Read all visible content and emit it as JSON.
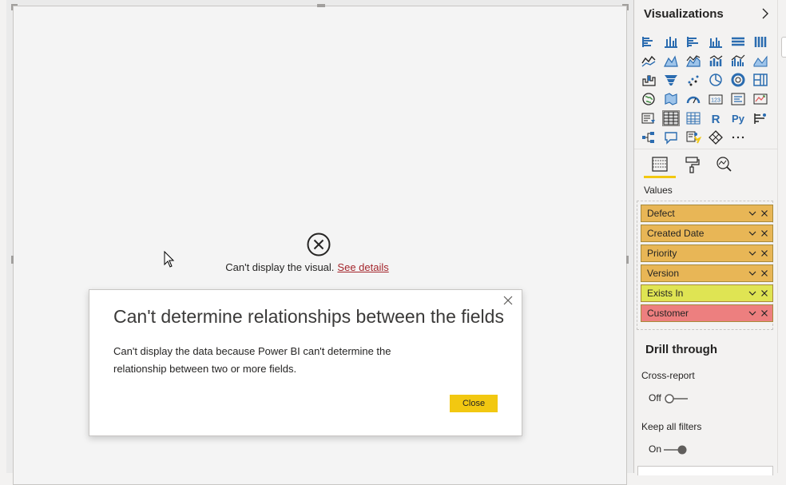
{
  "canvas": {
    "error_message": "Can't display the visual.",
    "error_link": "See details"
  },
  "dialog": {
    "title": "Can't determine relationships between the fields",
    "body": "Can't display the data because Power BI can't determine the relationship between two or more fields.",
    "close_button": "Close"
  },
  "visualizations": {
    "title": "Visualizations",
    "expand_icon": "chevron-right-icon",
    "icons": [
      "stacked-bar-chart-icon",
      "stacked-column-chart-icon",
      "clustered-bar-chart-icon",
      "clustered-column-chart-icon",
      "100-stacked-bar-chart-icon",
      "100-stacked-column-chart-icon",
      "line-chart-icon",
      "area-chart-icon",
      "stacked-area-chart-icon",
      "line-and-stacked-column-icon",
      "line-and-clustered-column-icon",
      "ribbon-chart-icon",
      "waterfall-chart-icon",
      "funnel-chart-icon",
      "scatter-chart-icon",
      "pie-chart-icon",
      "donut-chart-icon",
      "treemap-icon",
      "map-icon",
      "filled-map-icon",
      "gauge-icon",
      "card-icon",
      "multi-row-card-icon",
      "kpi-icon",
      "slicer-icon",
      "table-icon",
      "matrix-icon",
      "r-script-visual-icon",
      "python-visual-icon",
      "key-influencers-icon",
      "decomposition-tree-icon",
      "qna-icon",
      "smart-narrative-icon",
      "paginated-report-icon",
      "more-visuals-icon"
    ],
    "tabs": [
      "fields-tab-icon",
      "format-tab-icon",
      "analytics-tab-icon"
    ],
    "values_label": "Values",
    "fields": [
      {
        "label": "Defect",
        "color": "#e8b656"
      },
      {
        "label": "Created Date",
        "color": "#e8b656"
      },
      {
        "label": "Priority",
        "color": "#e8b656"
      },
      {
        "label": "Version",
        "color": "#e8b656"
      },
      {
        "label": "Exists In",
        "color": "#dfe453"
      },
      {
        "label": "Customer",
        "color": "#ed7f7f"
      }
    ],
    "drill_through": {
      "title": "Drill through",
      "cross_report": {
        "label": "Cross-report",
        "state": "Off"
      },
      "keep_all_filters": {
        "label": "Keep all filters",
        "state": "On"
      }
    }
  },
  "colors": {
    "accent": "#f2c811",
    "error_link": "#a4262c",
    "field_orange": "#e8b656",
    "field_yellow": "#dfe453",
    "field_red": "#ed7f7f"
  }
}
